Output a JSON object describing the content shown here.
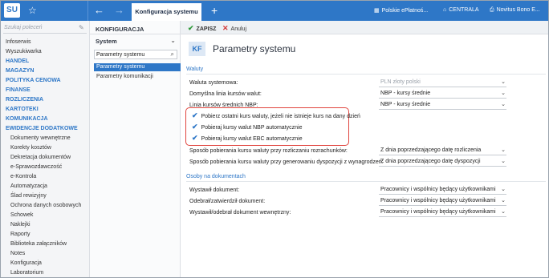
{
  "app": {
    "logo": "SU",
    "favorite_icon": "star-icon",
    "active_tab": "Konfiguracja systemu",
    "add_tab": "+",
    "top_right": [
      {
        "label": "Polskie ePłatnoś...",
        "icon": "building-icon"
      },
      {
        "label": "CENTRALA",
        "icon": "house-icon"
      },
      {
        "label": "Novitus Bono E...",
        "icon": "printer-icon"
      }
    ]
  },
  "sidebar": {
    "search_placeholder": "Szukaj poleceń",
    "items": [
      {
        "label": "Infoserwis",
        "type": "plain"
      },
      {
        "label": "Wyszukiwarka",
        "type": "plain"
      },
      {
        "label": "HANDEL",
        "type": "head"
      },
      {
        "label": "MAGAZYN",
        "type": "head"
      },
      {
        "label": "POLITYKA CENOWA",
        "type": "head"
      },
      {
        "label": "FINANSE",
        "type": "head"
      },
      {
        "label": "ROZLICZENIA",
        "type": "head"
      },
      {
        "label": "KARTOTEKI",
        "type": "head"
      },
      {
        "label": "KOMUNIKACJA",
        "type": "head"
      },
      {
        "label": "EWIDENCJE DODATKOWE",
        "type": "head"
      },
      {
        "label": "Dokumenty wewnętrzne",
        "type": "sub"
      },
      {
        "label": "Korekty kosztów",
        "type": "sub"
      },
      {
        "label": "Dekretacja dokumentów",
        "type": "sub"
      },
      {
        "label": "e-Sprawozdawczość",
        "type": "sub"
      },
      {
        "label": "e-Kontrola",
        "type": "sub"
      },
      {
        "label": "Automatyzacja",
        "type": "sub"
      },
      {
        "label": "Ślad rewizyjny",
        "type": "sub"
      },
      {
        "label": "Ochrona danych osobowych",
        "type": "sub"
      },
      {
        "label": "Schowek",
        "type": "sub"
      },
      {
        "label": "Naklejki",
        "type": "sub"
      },
      {
        "label": "Raporty",
        "type": "sub"
      },
      {
        "label": "Biblioteka załączników",
        "type": "sub"
      },
      {
        "label": "Notes",
        "type": "sub"
      },
      {
        "label": "Konfiguracja",
        "type": "sub"
      },
      {
        "label": "Laboratorium",
        "type": "sub"
      }
    ]
  },
  "config_panel": {
    "title": "KONFIGURACJA",
    "group_select": "System",
    "search_value": "Parametry systemu",
    "items": [
      "Parametry systemu",
      "Parametry komunikacji"
    ]
  },
  "toolbar": {
    "save_label": "ZAPISZ",
    "cancel_label": "Anuluj"
  },
  "page": {
    "badge": "KF",
    "title": "Parametry systemu"
  },
  "currencies": {
    "section": "Waluty",
    "system_currency": {
      "label": "Waluta systemowa:",
      "value": "PLN   złoty polski"
    },
    "default_rate_line": {
      "label": "Domyślna linia kursów walut:",
      "value": "NBP - kursy średnie"
    },
    "nbp_avg_line": {
      "label": "Linia kursów średnich NBP:",
      "value": "NBP - kursy średnie"
    },
    "checkboxes": [
      {
        "label": "Pobierz ostatni kurs waluty, jeżeli nie istnieje kurs na dany dzień",
        "checked": true
      },
      {
        "label": "Pobieraj kursy walut NBP automatycznie",
        "checked": true
      },
      {
        "label": "Pobieraj kursy walut EBC automatycznie",
        "checked": true
      }
    ],
    "settlement_rate": {
      "label": "Sposób pobierania kursu waluty przy rozliczaniu rozrachunków:",
      "value": "Z dnia poprzedzającego datę rozliczenia"
    },
    "disposition_rate": {
      "label": "Sposób pobierania kursu waluty przy generowaniu dyspozycji z wynagrodzeń:",
      "value": "Z dnia poprzedzającego datę dyspozycji"
    }
  },
  "persons": {
    "section": "Osoby na dokumentach",
    "issued_by": {
      "label": "Wystawił dokument:",
      "value": "Pracownicy i wspólnicy będący użytkownikami"
    },
    "received_by": {
      "label": "Odebrał/zatwierdził dokument:",
      "value": "Pracownicy i wspólnicy będący użytkownikami"
    },
    "internal_doc": {
      "label": "Wystawił/odebrał dokument wewnętrzny:",
      "value": "Pracownicy i wspólnicy będący użytkownikami"
    }
  }
}
